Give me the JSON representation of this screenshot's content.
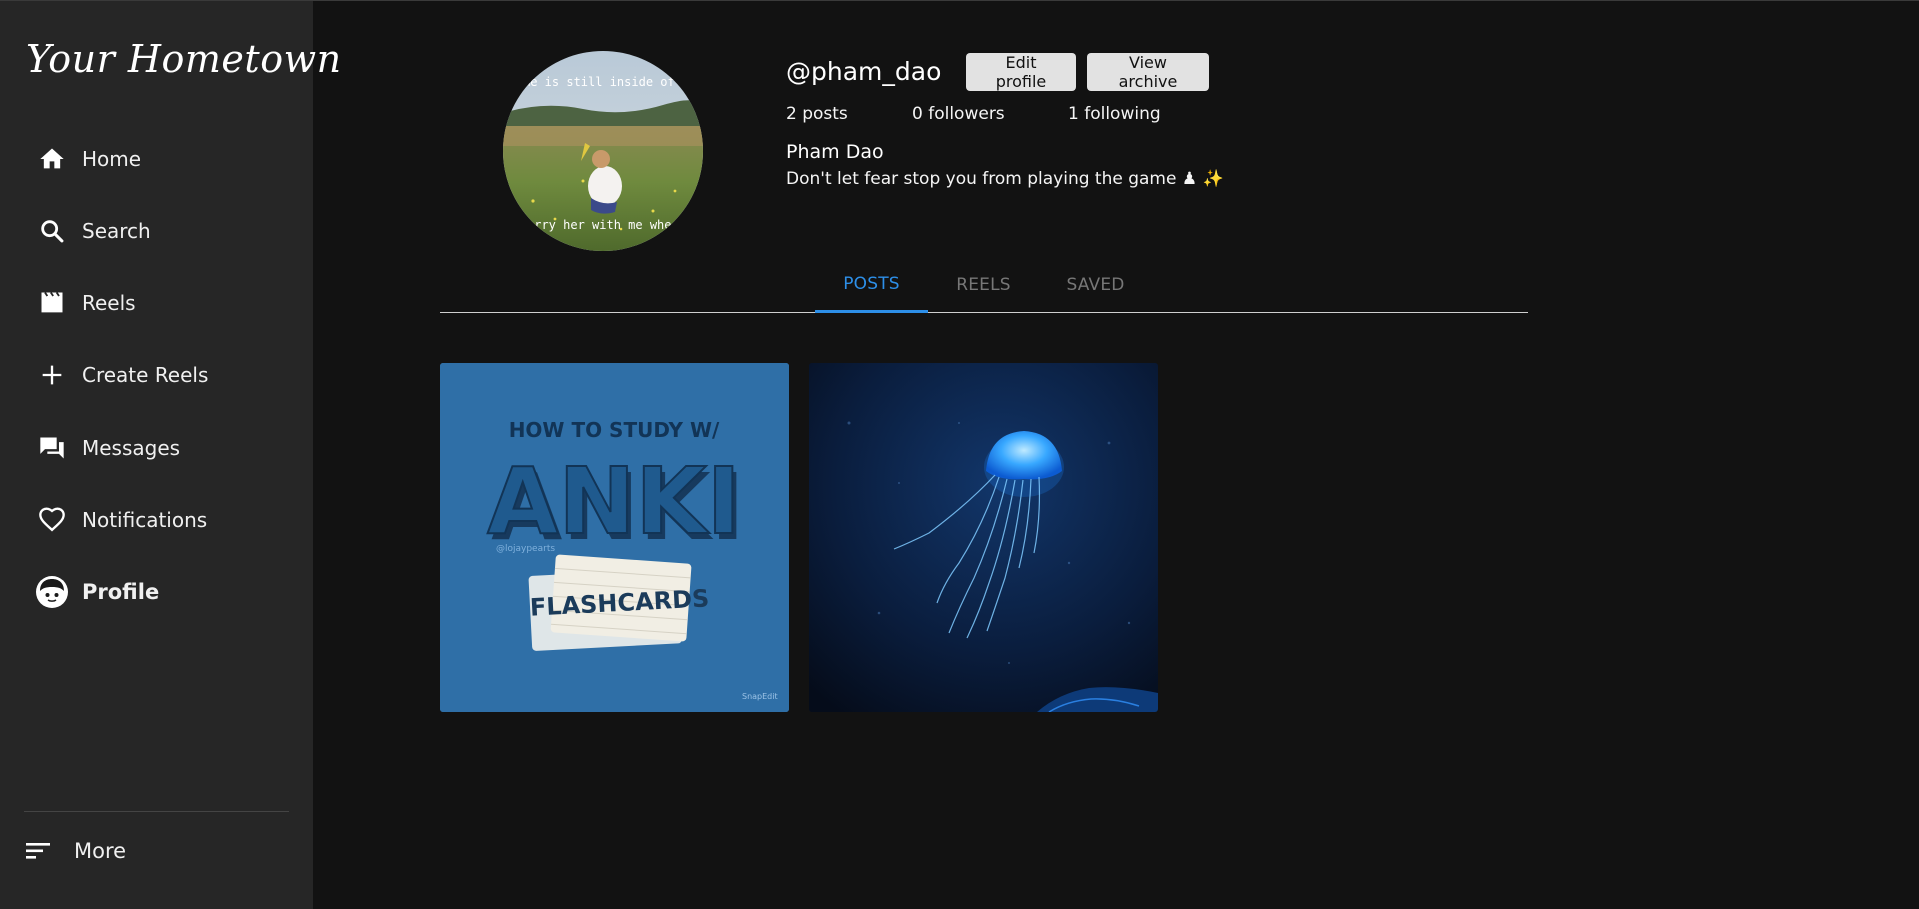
{
  "app": {
    "logo": "Your Hometown"
  },
  "sidebar": {
    "items": [
      {
        "label": "Home",
        "icon": "home-icon"
      },
      {
        "label": "Search",
        "icon": "search-icon"
      },
      {
        "label": "Reels",
        "icon": "reels-icon"
      },
      {
        "label": "Create Reels",
        "icon": "plus-icon"
      },
      {
        "label": "Messages",
        "icon": "messages-icon"
      },
      {
        "label": "Notifications",
        "icon": "heart-icon"
      },
      {
        "label": "Profile",
        "icon": "profile-avatar-icon",
        "active": true
      }
    ],
    "more_label": "More"
  },
  "profile": {
    "username": "@pham_dao",
    "edit_label": "Edit profile",
    "archive_label": "View archive",
    "posts_count": "2 posts",
    "followers_count": "0 followers",
    "following_count": "1 following",
    "full_name": "Pham Dao",
    "bio": "Don't let fear stop you from playing the game ♟ ✨",
    "avatar_caption_top": "me is still inside of me",
    "avatar_caption_bottom": "arry her with me wherever"
  },
  "tabs": [
    {
      "label": "POSTS",
      "active": true
    },
    {
      "label": "REELS"
    },
    {
      "label": "SAVED"
    }
  ],
  "posts": [
    {
      "line1": "HOW TO STUDY W/",
      "line2": "ANKI",
      "line3": "FLASHCARDS",
      "handle": "@lojaypearts",
      "watermark": "SnapEdit"
    },
    {
      "subject": "jellyfish"
    }
  ],
  "colors": {
    "accent": "#2d8fe8",
    "sidebar_bg": "#262626",
    "page_bg": "#121212"
  }
}
